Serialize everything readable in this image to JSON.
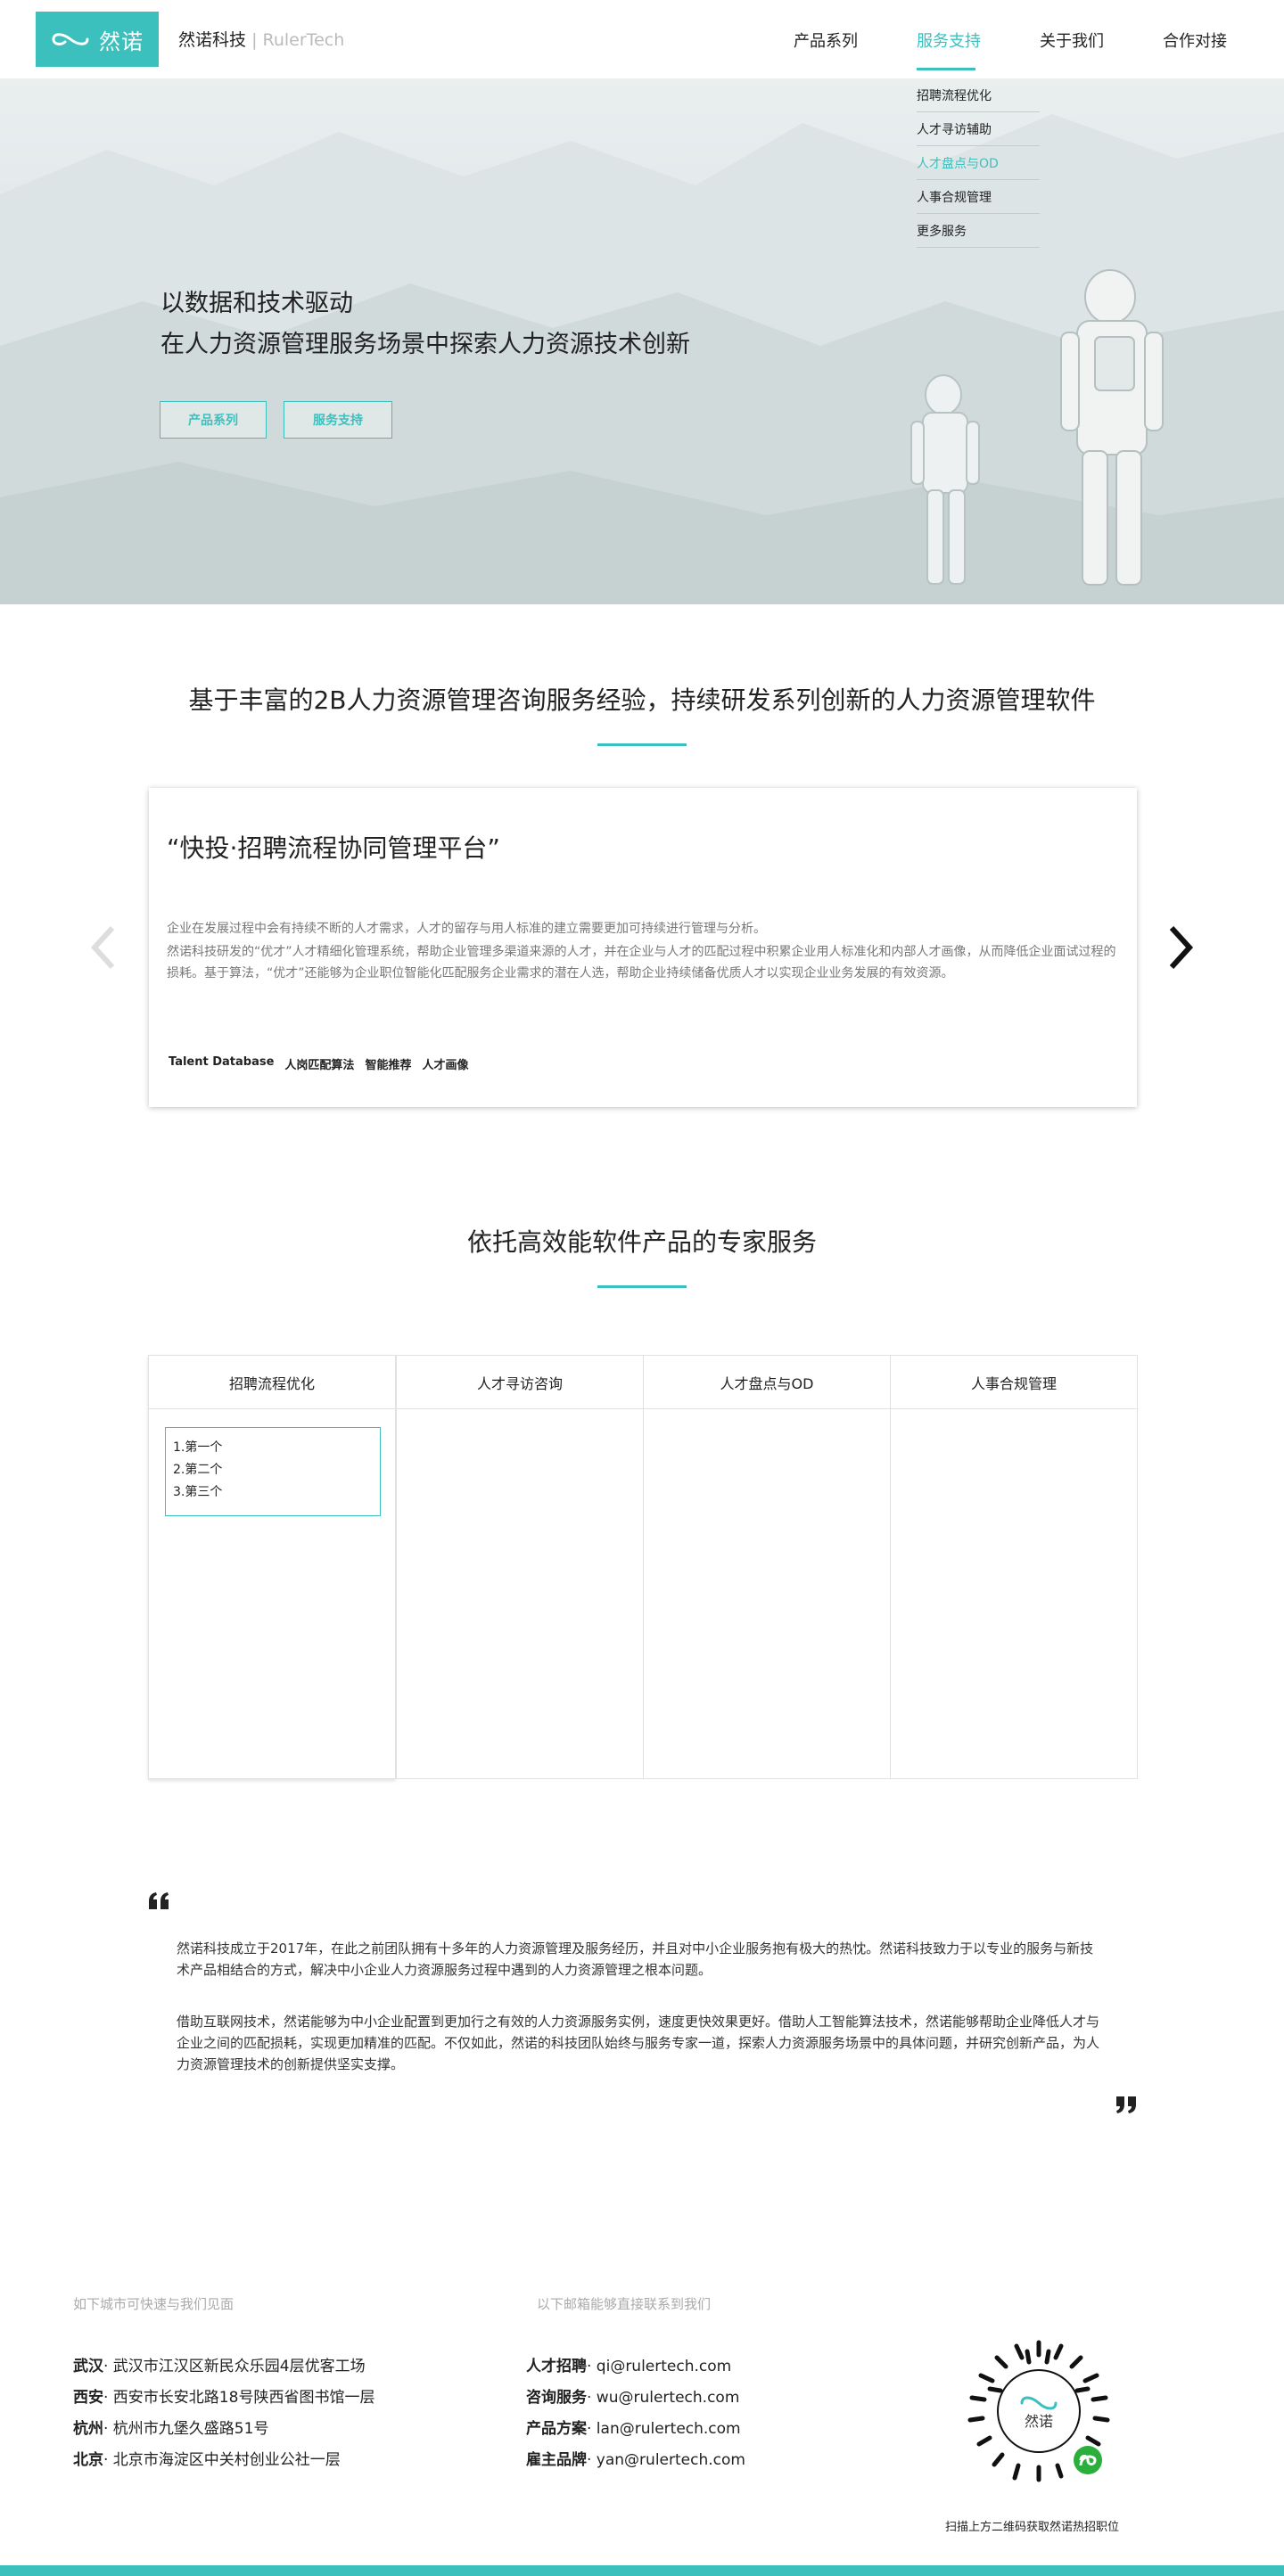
{
  "brand": {
    "logo_text": "然诺",
    "company_cn": "然诺科技",
    "company_sep": "|",
    "company_en": "RulerTech",
    "accent": "#3cc0bd"
  },
  "nav": {
    "items": [
      {
        "label": "产品系列",
        "active": false
      },
      {
        "label": "服务支持",
        "active": true
      },
      {
        "label": "关于我们",
        "active": false
      },
      {
        "label": "合作对接",
        "active": false
      }
    ]
  },
  "dropdown": {
    "items": [
      {
        "label": "招聘流程优化",
        "active": false
      },
      {
        "label": "人才寻访辅助",
        "active": false
      },
      {
        "label": "人才盘点与OD",
        "active": true
      },
      {
        "label": "人事合规管理",
        "active": false
      },
      {
        "label": "更多服务",
        "active": false
      }
    ]
  },
  "hero": {
    "line1": "以数据和技术驱动",
    "line2": "在人力资源管理服务场景中探索人力资源技术创新",
    "buttons": [
      "产品系列",
      "服务支持"
    ]
  },
  "products": {
    "section_title": "基于丰富的2B人力资源管理咨询服务经验，持续研发系列创新的人力资源管理软件",
    "card_title": "“快投·招聘流程协同管理平台”",
    "card_p1": "企业在发展过程中会有持续不断的人才需求，人才的留存与用人标准的建立需要更加可持续进行管理与分析。",
    "card_p2": "然诺科技研发的“优才”人才精细化管理系统，帮助企业管理多渠道来源的人才，并在企业与人才的匹配过程中积累企业用人标准化和内部人才画像，从而降低企业面试过程的损耗。基于算法，“优才”还能够为企业职位智能化匹配服务企业需求的潜在人选，帮助企业持续储备优质人才以实现企业业务发展的有效资源。",
    "tags": [
      "Talent Database",
      "人岗匹配算法",
      "智能推荐",
      "人才画像"
    ],
    "prev_icon": "chevron-left-icon",
    "next_icon": "chevron-right-icon"
  },
  "services": {
    "section_title": "依托高效能软件产品的专家服务",
    "columns": [
      {
        "label": "招聘流程优化",
        "items": [
          "1.第一个",
          "2.第二个",
          "3.第三个"
        ]
      },
      {
        "label": "人才寻访咨询",
        "items": []
      },
      {
        "label": "人才盘点与OD",
        "items": []
      },
      {
        "label": "人事合规管理",
        "items": []
      }
    ]
  },
  "about": {
    "p1": "然诺科技成立于2017年，在此之前团队拥有十多年的人力资源管理及服务经历，并且对中小企业服务抱有极大的热忱。然诺科技致力于以专业的服务与新技术产品相结合的方式，解决中小企业人力资源服务过程中遇到的人力资源管理之根本问题。",
    "p2": "借助互联网技术，然诺能够为中小企业配置到更加行之有效的人力资源服务实例，速度更快效果更好。借助人工智能算法技术，然诺能够帮助企业降低人才与企业之间的匹配损耗，实现更加精准的匹配。不仅如此，然诺的科技团队始终与服务专家一道，探索人力资源服务场景中的具体问题，并研究创新产品，为人力资源管理技术的创新提供坚实支撑。"
  },
  "footer": {
    "cities_note": "如下城市可快速与我们见面",
    "mail_note": "以下邮箱能够直接联系到我们",
    "cities": [
      {
        "city": "武汉",
        "addr": "· 武汉市江汉区新民众乐园4层优客工场"
      },
      {
        "city": "西安",
        "addr": "· 西安市长安北路18号陕西省图书馆一层"
      },
      {
        "city": "杭州",
        "addr": "· 杭州市九堡久盛路51号"
      },
      {
        "city": "北京",
        "addr": "· 北京市海淀区中关村创业公社一层"
      }
    ],
    "emails": [
      {
        "label": "人才招聘",
        "email": "· qi@rulertech.com"
      },
      {
        "label": "咨询服务",
        "email": "· wu@rulertech.com"
      },
      {
        "label": "产品方案",
        "email": "· lan@rulertech.com"
      },
      {
        "label": "雇主品牌",
        "email": "· yan@rulertech.com"
      }
    ],
    "qr_logo_text": "然诺",
    "qr_caption": "扫描上方二维码获取然诺热招职位"
  }
}
